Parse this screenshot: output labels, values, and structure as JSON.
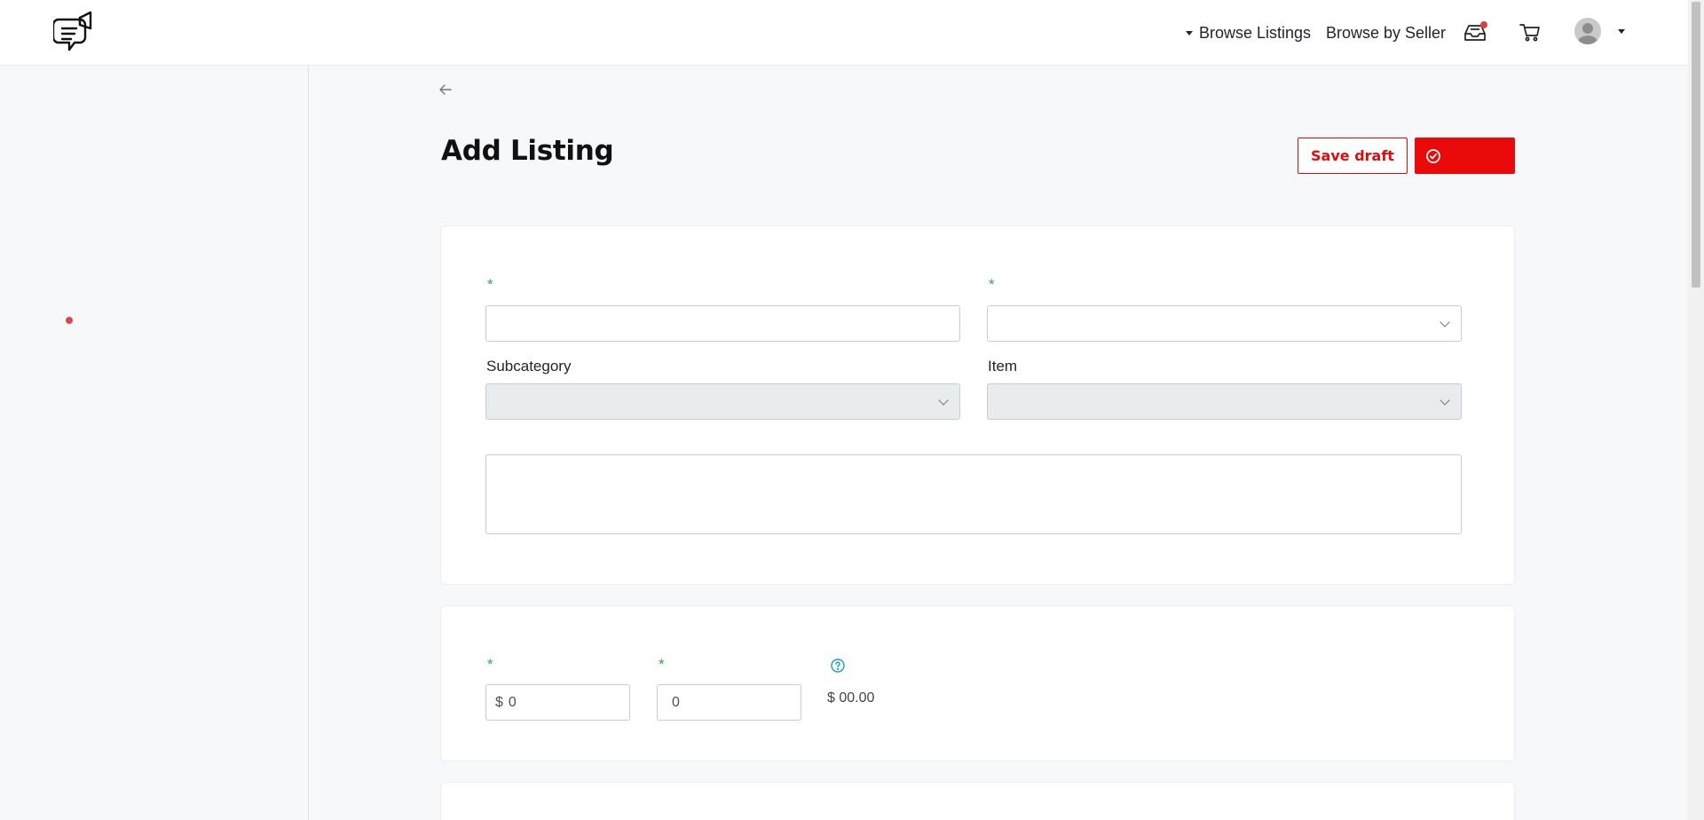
{
  "nav": {
    "browse_listings": "Browse Listings",
    "browse_by_seller": "Browse by Seller"
  },
  "page": {
    "title": "Add Listing",
    "save_draft": "Save draft",
    "publish": ""
  },
  "form": {
    "required_mark": "*",
    "subcategory_label": "Subcategory",
    "item_label": "Item",
    "price_prefix": "$",
    "price_value": "0",
    "quantity_value": "0",
    "total": "$ 00.00"
  },
  "colors": {
    "accent": "#eb0a0a",
    "required": "#2fa84f",
    "help": "#17a2b8"
  }
}
